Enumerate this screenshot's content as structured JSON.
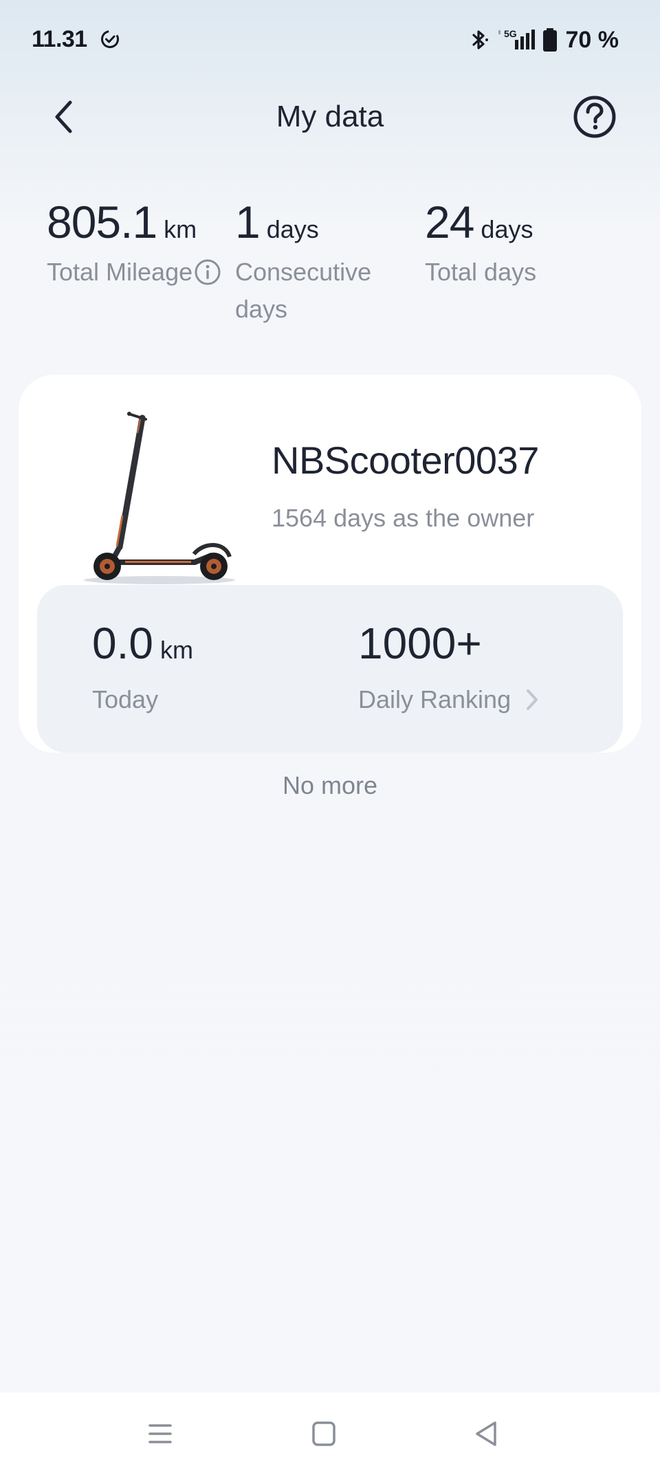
{
  "status_bar": {
    "time": "11.31",
    "battery": "70 %",
    "network": "5G",
    "icons": [
      "check-circle-icon",
      "bluetooth-icon",
      "signal-icon",
      "battery-icon"
    ]
  },
  "header": {
    "title": "My data",
    "icons": [
      "back-chevron-icon",
      "help-question-icon"
    ]
  },
  "stats": {
    "mileage": {
      "value": "805.1",
      "unit": "km",
      "label": "Total Mileage"
    },
    "consecutive": {
      "value": "1",
      "unit": "days",
      "label": "Consecutive days"
    },
    "total_days": {
      "value": "24",
      "unit": "days",
      "label": "Total days"
    }
  },
  "vehicle": {
    "name": "NBScooter0037",
    "owner_days": "1564 days as the owner",
    "today": {
      "value": "0.0",
      "unit": "km",
      "label": "Today"
    },
    "ranking": {
      "value": "1000+",
      "label": "Daily Ranking"
    }
  },
  "footer_text": "No more",
  "nav": {
    "icons": [
      "menu-icon",
      "home-square-icon",
      "back-triangle-icon"
    ]
  },
  "colors": {
    "text_primary": "#1f2433",
    "text_secondary": "#8a8f99",
    "card": "#ffffff",
    "inner_card": "#eef1f5",
    "accent_orange": "#c8693a"
  }
}
